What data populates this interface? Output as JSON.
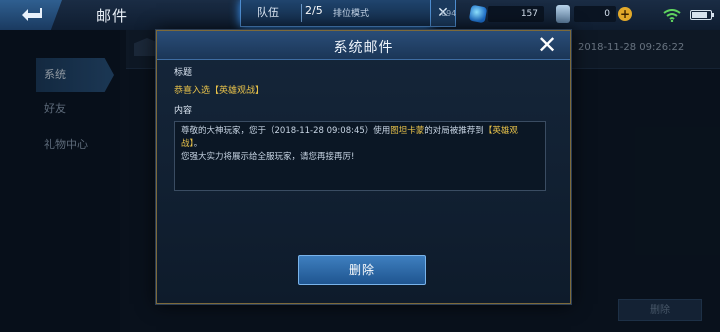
{
  "topbar": {
    "title": "邮件",
    "team_label": "队伍",
    "team_count": "2/5",
    "team_mode": "排位模式",
    "close_glyph": "✕",
    "resource_small": "694",
    "gems": "157",
    "coupons": "0",
    "plus": "+"
  },
  "sidebar": {
    "items": [
      {
        "label": "系统",
        "active": true
      },
      {
        "label": "好友",
        "active": false
      },
      {
        "label": "礼物中心",
        "active": false
      }
    ]
  },
  "mail_list": {
    "date": "2018-11-28 09:26:22",
    "delete_label": "删除"
  },
  "modal": {
    "title": "系统邮件",
    "close_glyph": "✕",
    "subject_label": "标题",
    "subject": "恭喜入选【英雄观战】",
    "content_label": "内容",
    "body_part1": "尊敬的大神玩家，您于（2018-11-28 09:08:45）使用",
    "body_hero": "图坦卡蒙",
    "body_part2": "的对局被推荐到",
    "body_tag": "【英雄观战】",
    "body_part3": "。",
    "body_line2": "您强大实力将展示给全服玩家，请您再接再厉!",
    "delete_label": "删除"
  },
  "colors": {
    "accent_gold": "#e8c24a",
    "button_blue": "#2d6aa8"
  },
  "icons": [
    "back-arrow-icon",
    "gem-icon",
    "coupon-icon",
    "plus-icon",
    "wifi-icon",
    "battery-icon",
    "close-icon",
    "mail-icon"
  ]
}
